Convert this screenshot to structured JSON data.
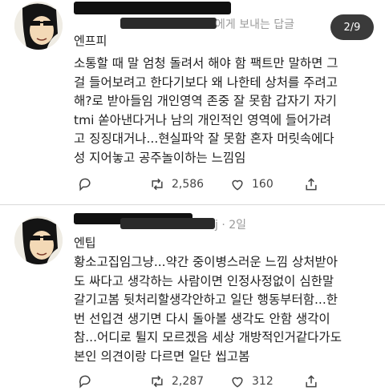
{
  "counter": "2/9",
  "tweets": [
    {
      "meta_visible": "에게 보내는 답글",
      "name": "엔프피",
      "lines": [
        "소통할 때 말 엄청 돌려서 해야 함 팩트만 말하면 그",
        "걸 들어보려고 한다기보다 왜 나한테 상처를 주려고",
        "해?로 받아들임 개인영역 존중 잘 못함 갑자기 자기",
        "tmi 쏟아낸다거나 남의 개인적인 영역에 들어가려",
        "고 징징대거나...현실파악 잘 못함 혼자 머릿속에다",
        "성 지어놓고 공주놀이하는 느낌임"
      ],
      "retweets": "2,586",
      "likes": "160"
    },
    {
      "meta_visible": "j · 2일",
      "name": "엔팁",
      "lines": [
        "황소고집임그냥...약간 중이병스러운 느낌 상처받아",
        "도 싸다고 생각하는 사람이면 인정사정없이 심한말",
        "갈기고봄 뒷처리할생각안하고 일단 행동부터함...한",
        "번 선입견 생기면 다시 돌아볼 생각도 안함 생각이",
        "참...어디로 튈지 모르겠음 세상 개방적인거같다가도",
        "본인 의견이랑 다르면 일단 씹고봄"
      ],
      "retweets": "2,287",
      "likes": "312"
    }
  ],
  "icons": [
    "reply-icon",
    "retweet-icon",
    "like-icon",
    "share-icon"
  ]
}
